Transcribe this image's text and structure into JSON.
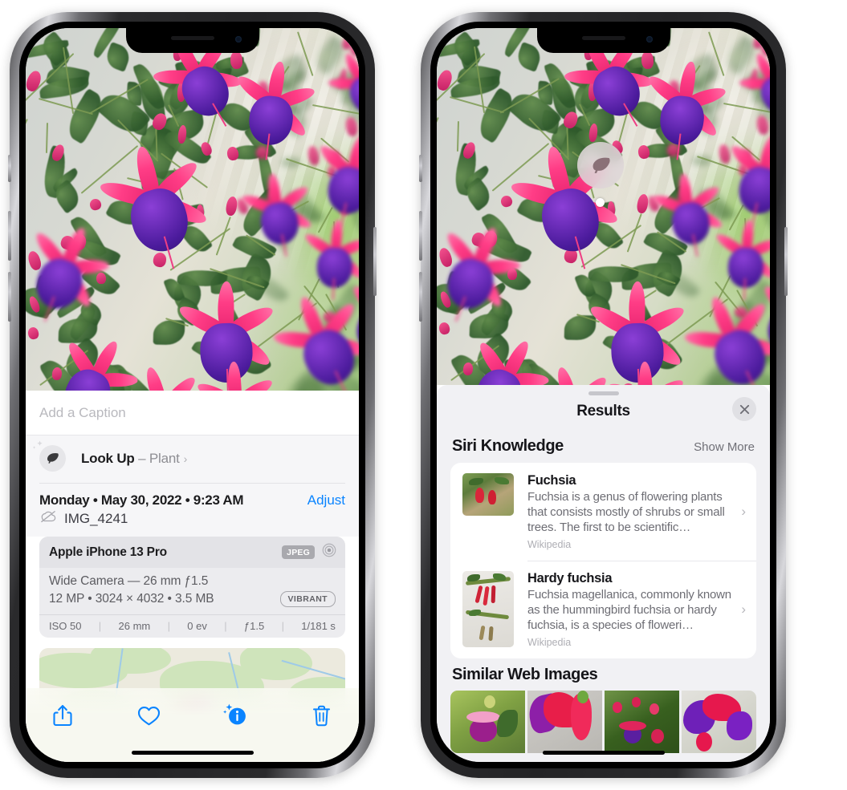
{
  "left_phone": {
    "caption_placeholder": "Add a Caption",
    "lookup": {
      "label": "Look Up",
      "separator": " – ",
      "subject": "Plant",
      "chevron": "›",
      "icon": "leaf-icon"
    },
    "metadata": {
      "date": "Monday • May 30, 2022 • 9:23 AM",
      "adjust_label": "Adjust",
      "filename": "IMG_4241",
      "cloud_icon": "icloud-slash-icon"
    },
    "camera_card": {
      "device": "Apple iPhone 13 Pro",
      "format_badge": "JPEG",
      "raw_icon": "aperture-icon",
      "lens_line": "Wide Camera — 26 mm ƒ1.5",
      "file_line": "12 MP • 3024 × 4032 • 3.5 MB",
      "style_badge": "VIBRANT",
      "exif": [
        "ISO 50",
        "26 mm",
        "0 ev",
        "ƒ1.5",
        "1/181 s"
      ]
    },
    "toolbar": [
      {
        "name": "share-button",
        "icon": "share-icon"
      },
      {
        "name": "favorite-button",
        "icon": "heart-icon"
      },
      {
        "name": "info-button",
        "icon": "info-sparkle-icon"
      },
      {
        "name": "delete-button",
        "icon": "trash-icon"
      }
    ],
    "accent_color": "#0a84ff"
  },
  "right_phone": {
    "photo_badge": {
      "icon": "leaf-icon",
      "name": "visual-lookup-badge"
    },
    "sheet": {
      "title": "Results",
      "close_icon": "close-icon",
      "sections": [
        {
          "title": "Siri Knowledge",
          "action": "Show More",
          "items": [
            {
              "title": "Fuchsia",
              "snippet": "Fuchsia is a genus of flowering plants that consists mostly of shrubs or small trees. The first to be scientific…",
              "source": "Wikipedia",
              "chevron": "›"
            },
            {
              "title": "Hardy fuchsia",
              "snippet": "Fuchsia magellanica, commonly known as the hummingbird fuchsia or hardy fuchsia, is a species of floweri…",
              "source": "Wikipedia",
              "chevron": "›"
            }
          ]
        },
        {
          "title": "Similar Web Images",
          "thumbnails": [
            "web-image-1",
            "web-image-2",
            "web-image-3",
            "web-image-4"
          ]
        }
      ]
    }
  }
}
